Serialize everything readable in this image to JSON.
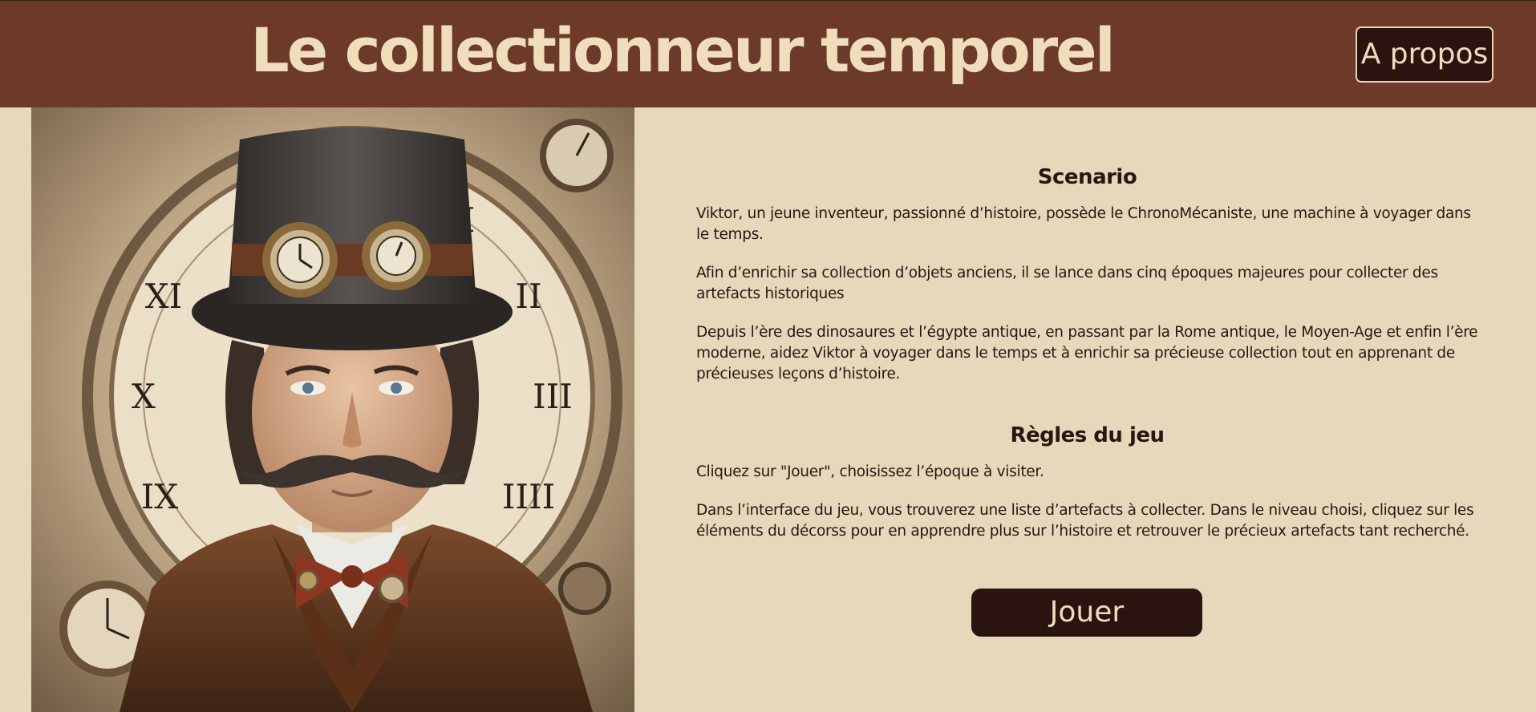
{
  "header": {
    "title": "Le collectionneur temporel",
    "about_label": "A propos"
  },
  "portrait": {
    "description_icon": "steampunk-inventor-portrait"
  },
  "scenario": {
    "title": "Scenario",
    "paragraphs": [
      "Viktor, un jeune inventeur, passionné d’histoire, possède le ChronoMécaniste, une machine à voyager dans le temps.",
      "Afin d’enrichir sa collection d’objets anciens, il se lance dans cinq époques majeures pour collecter des artefacts historiques",
      "Depuis l’ère des dinosaures et l’égypte antique, en passant par la Rome antique, le Moyen-Age et enfin l’ère moderne, aidez Viktor à voyager dans le temps et à enrichir sa précieuse collection tout en apprenant de précieuses leçons d’histoire."
    ]
  },
  "rules": {
    "title": "Règles du jeu",
    "paragraphs": [
      "Cliquez sur \"Jouer\", choisissez l’époque à visiter.",
      "Dans l’interface du jeu, vous trouverez une liste d’artefacts à collecter. Dans le niveau choisi, cliquez sur les éléments du décorss pour en apprendre plus sur l’histoire et retrouver le précieux artefacts tant recherché."
    ]
  },
  "play_label": "Jouer",
  "colors": {
    "header_bg": "#6d3a29",
    "page_bg": "#e8d8bb",
    "button_bg": "#2b1410",
    "text": "#2a1510",
    "title_text": "#efddbc"
  }
}
